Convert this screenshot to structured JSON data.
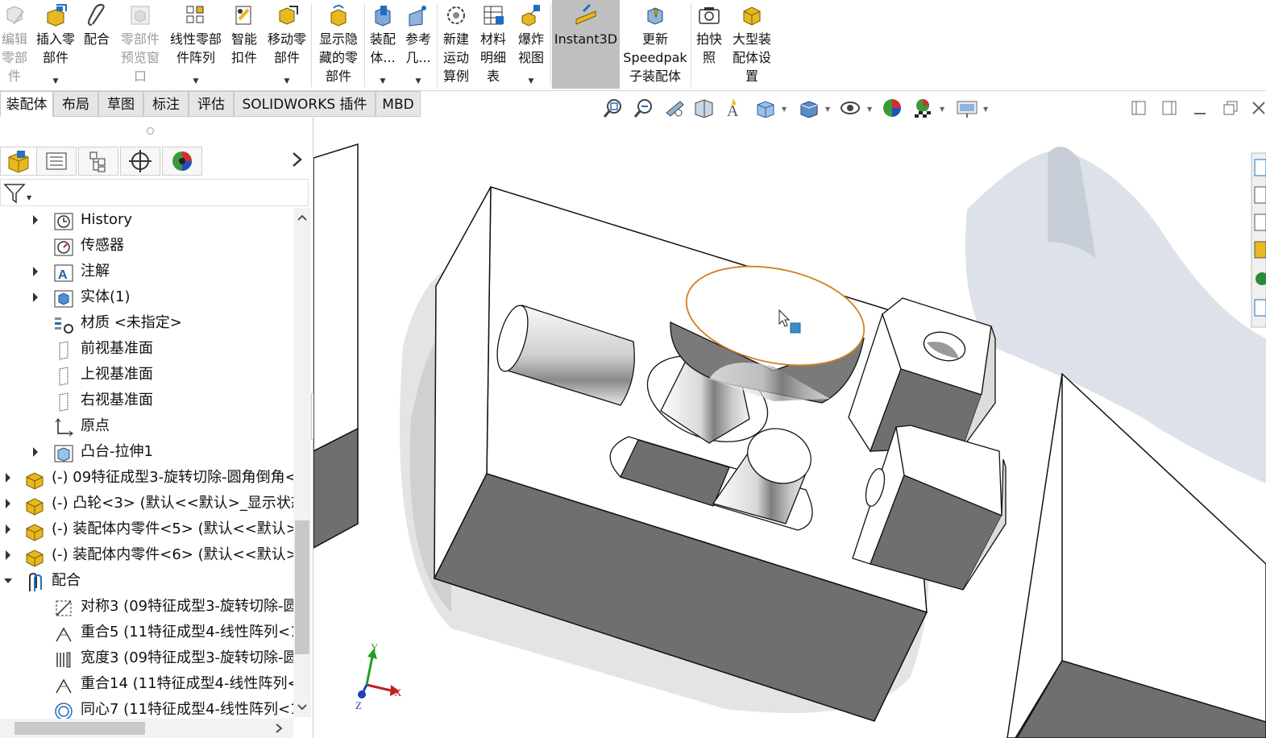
{
  "ribbon": {
    "buttons": [
      {
        "label": "编辑\n零部\n件",
        "icon": "edit-component-icon",
        "state": "disabled"
      },
      {
        "label": "插入零\n部件",
        "icon": "insert-component-icon",
        "dropdown": true
      },
      {
        "label": "配合",
        "icon": "mate-paperclip-icon"
      },
      {
        "label": "零部件\n预览窗\n口",
        "icon": "component-preview-icon",
        "state": "disabled"
      },
      {
        "label": "线性零部\n件阵列",
        "icon": "linear-pattern-icon",
        "dropdown": true
      },
      {
        "label": "智能\n扣件",
        "icon": "smart-fastener-icon"
      },
      {
        "label": "移动零\n部件",
        "icon": "move-component-icon",
        "dropdown": true
      },
      {
        "label": "显示隐\n藏的零\n部件",
        "icon": "show-hidden-icon"
      },
      {
        "label": "装配\n体...",
        "icon": "assembly-features-icon",
        "dropdown": true
      },
      {
        "label": "参考\n几...",
        "icon": "reference-geometry-icon",
        "dropdown": true
      },
      {
        "label": "新建\n运动\n算例",
        "icon": "motion-study-icon"
      },
      {
        "label": "材料\n明细\n表",
        "icon": "bill-of-materials-icon"
      },
      {
        "label": "爆炸\n视图",
        "icon": "exploded-view-icon",
        "dropdown": true
      },
      {
        "label": "Instant3D",
        "icon": "instant3d-icon",
        "state": "active"
      },
      {
        "label": "更新\nSpeedpak\n子装配体",
        "icon": "speedpak-icon"
      },
      {
        "label": "拍快\n照",
        "icon": "snapshot-camera-icon"
      },
      {
        "label": "大型装\n配体设\n置",
        "icon": "large-assembly-icon"
      }
    ]
  },
  "tabs": [
    "装配体",
    "布局",
    "草图",
    "标注",
    "评估",
    "SOLIDWORKS 插件",
    "MBD"
  ],
  "tree": [
    {
      "label": "History",
      "icon": "history-icon",
      "expandable": true
    },
    {
      "label": "传感器",
      "icon": "sensor-icon"
    },
    {
      "label": "注解",
      "icon": "annotation-icon",
      "expandable": true
    },
    {
      "label": "实体(1)",
      "icon": "solid-body-icon",
      "expandable": true
    },
    {
      "label": "材质 <未指定>",
      "icon": "material-icon"
    },
    {
      "label": "前视基准面",
      "icon": "plane-icon"
    },
    {
      "label": "上视基准面",
      "icon": "plane-icon"
    },
    {
      "label": "右视基准面",
      "icon": "plane-icon"
    },
    {
      "label": "原点",
      "icon": "origin-icon"
    },
    {
      "label": "凸台-拉伸1",
      "icon": "boss-extrude-icon",
      "expandable": true
    },
    {
      "label": "(-) 09特征成型3-旋转切除-圆角倒角<",
      "icon": "part-icon",
      "expandable": true,
      "level": 0
    },
    {
      "label": "(-) 凸轮<3> (默认<<默认>_显示状态",
      "icon": "part-icon",
      "expandable": true,
      "level": 0
    },
    {
      "label": "(-) 装配体内零件<5> (默认<<默认>_",
      "icon": "part-icon",
      "expandable": true,
      "level": 0
    },
    {
      "label": "(-) 装配体内零件<6> (默认<<默认>_",
      "icon": "part-icon",
      "expandable": true,
      "level": 0
    },
    {
      "label": "配合",
      "icon": "mates-folder-icon",
      "expanded": true,
      "level": 0
    },
    {
      "label": "对称3 (09特征成型3-旋转切除-圆",
      "icon": "symmetric-mate-icon"
    },
    {
      "label": "重合5 (11特征成型4-线性阵列<1",
      "icon": "coincident-mate-icon"
    },
    {
      "label": "宽度3 (09特征成型3-旋转切除-圆",
      "icon": "width-mate-icon"
    },
    {
      "label": "重合14 (11特征成型4-线性阵列<",
      "icon": "coincident-mate-icon"
    },
    {
      "label": "同心7 (11特征成型4-线性阵列<1",
      "icon": "concentric-mate-icon"
    }
  ],
  "triad": {
    "x": "X",
    "y": "Y",
    "z": "Z"
  },
  "colors": {
    "selection_edge": "#d08020",
    "active_button": "#bfbfbf",
    "accent_blue": "#1f6fc0"
  }
}
